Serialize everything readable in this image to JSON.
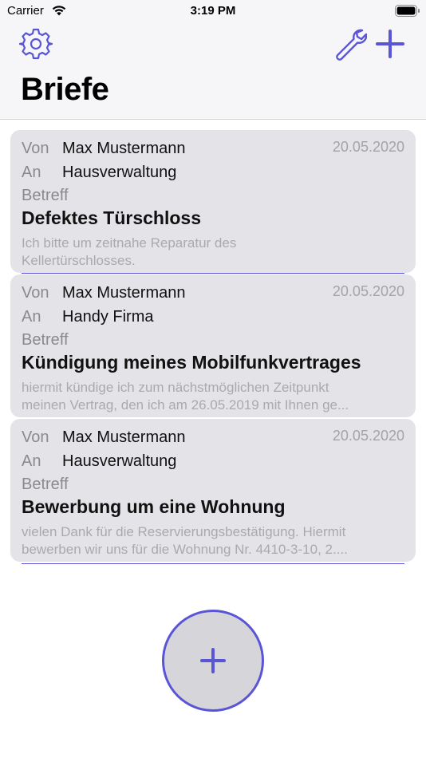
{
  "status_bar": {
    "carrier": "Carrier",
    "time": "3:19 PM"
  },
  "nav": {
    "title": "Briefe",
    "icons": [
      "gear-icon",
      "wrench-icon",
      "plus-icon"
    ],
    "accent_color": "#5a55d6"
  },
  "labels": {
    "from": "Von",
    "to": "An",
    "subject": "Betreff"
  },
  "letters": [
    {
      "from": "Max Mustermann",
      "to": "Hausverwaltung",
      "date": "20.05.2020",
      "subject": "Defektes Türschloss",
      "preview_line1": "Ich bitte um zeitnahe Reparatur des",
      "preview_line2": "Kellertürschlosses."
    },
    {
      "from": "Max Mustermann",
      "to": "Handy Firma",
      "date": "20.05.2020",
      "subject": "Kündigung meines Mobilfunkvertrages",
      "preview_line1": "hiermit kündige ich zum nächstmöglichen Zeitpunkt",
      "preview_line2": "meinen Vertrag, den ich am 26.05.2019 mit Ihnen ge..."
    },
    {
      "from": "Max Mustermann",
      "to": "Hausverwaltung",
      "date": "20.05.2020",
      "subject": "Bewerbung um eine Wohnung",
      "preview_line1": "vielen Dank für die Reservierungsbestätigung. Hiermit",
      "preview_line2": "bewerben wir uns für die Wohnung Nr. 4410-3-10, 2...."
    }
  ],
  "fab": {
    "icon": "plus-icon"
  }
}
